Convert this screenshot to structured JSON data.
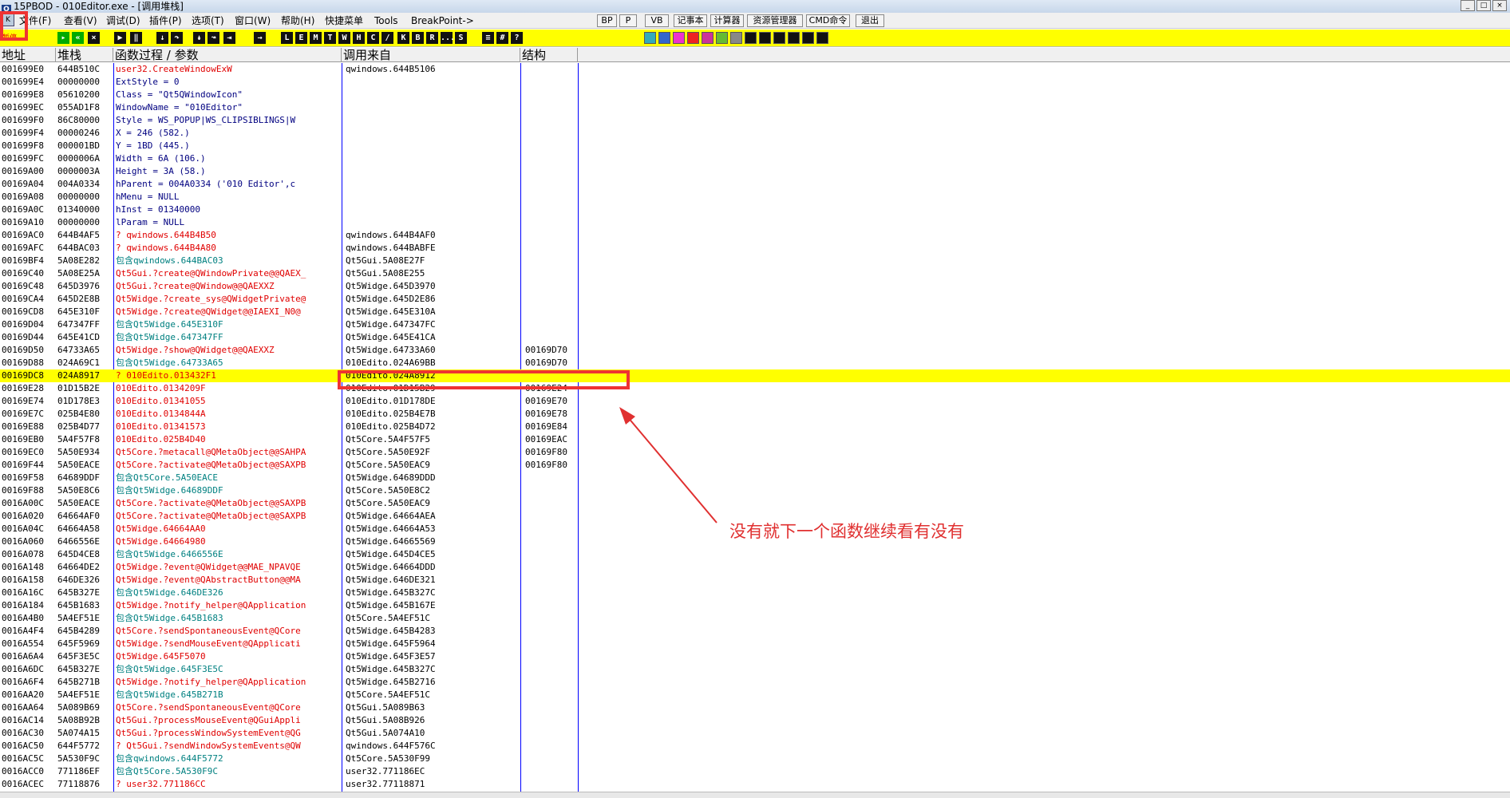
{
  "window": {
    "title": "15PBOD - 010Editor.exe - [调用堆栈]",
    "app_icon": "app-icon"
  },
  "menu": [
    "文件(F)",
    "查看(V)",
    "调试(D)",
    "插件(P)",
    "选项(T)",
    "窗口(W)",
    "帮助(H)",
    "快捷菜单",
    "Tools",
    "BreakPoint->"
  ],
  "plugin_buttons": [
    "BP",
    "P",
    "VB",
    "记事本",
    "计算器",
    "资源管理器",
    "CMD命令",
    "退出"
  ],
  "toolbar": {
    "status_text": "暂停",
    "left_icons": [
      "open",
      "restart",
      "close",
      "run",
      "pause",
      "step-into",
      "step-over",
      "trace-into",
      "trace-over",
      "execute-till-return",
      "goto"
    ],
    "letter_buttons": [
      "L",
      "E",
      "M",
      "T",
      "W",
      "H",
      "C",
      "/",
      "K",
      "B",
      "R",
      "...",
      "S"
    ],
    "right_icons": [
      "list",
      "grid",
      "help"
    ]
  },
  "columns": {
    "addr": "地址",
    "stack": "堆栈",
    "proc": "函数过程 / 参数",
    "called_from": "调用来自",
    "frame": "结构"
  },
  "rows": [
    {
      "addr": "001699E0",
      "stack": "644B510C",
      "proc": "user32.CreateWindowExW",
      "called_from": "qwindows.644B5106",
      "frame": "",
      "color": "red"
    },
    {
      "addr": "001699E4",
      "stack": "00000000",
      "proc": "  ExtStyle = 0",
      "called_from": "",
      "frame": "",
      "color": "navy"
    },
    {
      "addr": "001699E8",
      "stack": "05610200",
      "proc": "  Class = \"Qt5QWindowIcon\"",
      "called_from": "",
      "frame": "",
      "color": "navy"
    },
    {
      "addr": "001699EC",
      "stack": "055AD1F8",
      "proc": "  WindowName = \"010Editor\"",
      "called_from": "",
      "frame": "",
      "color": "navy"
    },
    {
      "addr": "001699F0",
      "stack": "86C80000",
      "proc": "  Style = WS_POPUP|WS_CLIPSIBLINGS|W",
      "called_from": "",
      "frame": "",
      "color": "navy"
    },
    {
      "addr": "001699F4",
      "stack": "00000246",
      "proc": "  X = 246 (582.)",
      "called_from": "",
      "frame": "",
      "color": "navy"
    },
    {
      "addr": "001699F8",
      "stack": "000001BD",
      "proc": "  Y = 1BD (445.)",
      "called_from": "",
      "frame": "",
      "color": "navy"
    },
    {
      "addr": "001699FC",
      "stack": "0000006A",
      "proc": "  Width = 6A (106.)",
      "called_from": "",
      "frame": "",
      "color": "navy"
    },
    {
      "addr": "00169A00",
      "stack": "0000003A",
      "proc": "  Height = 3A (58.)",
      "called_from": "",
      "frame": "",
      "color": "navy"
    },
    {
      "addr": "00169A04",
      "stack": "004A0334",
      "proc": "  hParent = 004A0334 ('010 Editor',c",
      "called_from": "",
      "frame": "",
      "color": "navy"
    },
    {
      "addr": "00169A08",
      "stack": "00000000",
      "proc": "  hMenu = NULL",
      "called_from": "",
      "frame": "",
      "color": "navy"
    },
    {
      "addr": "00169A0C",
      "stack": "01340000",
      "proc": "  hInst = 01340000",
      "called_from": "",
      "frame": "",
      "color": "navy"
    },
    {
      "addr": "00169A10",
      "stack": "00000000",
      "proc": "  lParam = NULL",
      "called_from": "",
      "frame": "",
      "color": "navy"
    },
    {
      "addr": "00169AC0",
      "stack": "644B4AF5",
      "proc": "? qwindows.644B4B50",
      "called_from": "qwindows.644B4AF0",
      "frame": "",
      "color": "red"
    },
    {
      "addr": "00169AFC",
      "stack": "644BAC03",
      "proc": "? qwindows.644B4A80",
      "called_from": "qwindows.644BABFE",
      "frame": "",
      "color": "red"
    },
    {
      "addr": "00169BF4",
      "stack": "5A08E282",
      "proc": "包含qwindows.644BAC03",
      "called_from": "Qt5Gui.5A08E27F",
      "frame": "",
      "color": "teal"
    },
    {
      "addr": "00169C40",
      "stack": "5A08E25A",
      "proc": "Qt5Gui.?create@QWindowPrivate@@QAEX_",
      "called_from": "Qt5Gui.5A08E255",
      "frame": "",
      "color": "red"
    },
    {
      "addr": "00169C48",
      "stack": "645D3976",
      "proc": "Qt5Gui.?create@QWindow@@QAEXXZ",
      "called_from": "Qt5Widge.645D3970",
      "frame": "",
      "color": "red"
    },
    {
      "addr": "00169CA4",
      "stack": "645D2E8B",
      "proc": "Qt5Widge.?create_sys@QWidgetPrivate@",
      "called_from": "Qt5Widge.645D2E86",
      "frame": "",
      "color": "red"
    },
    {
      "addr": "00169CD8",
      "stack": "645E310F",
      "proc": "Qt5Widge.?create@QWidget@@IAEXI_N0@",
      "called_from": "Qt5Widge.645E310A",
      "frame": "",
      "color": "red"
    },
    {
      "addr": "00169D04",
      "stack": "647347FF",
      "proc": "包含Qt5Widge.645E310F",
      "called_from": "Qt5Widge.647347FC",
      "frame": "",
      "color": "teal"
    },
    {
      "addr": "00169D44",
      "stack": "645E41CD",
      "proc": "包含Qt5Widge.647347FF",
      "called_from": "Qt5Widge.645E41CA",
      "frame": "",
      "color": "teal"
    },
    {
      "addr": "00169D50",
      "stack": "64733A65",
      "proc": "Qt5Widge.?show@QWidget@@QAEXXZ",
      "called_from": "Qt5Widge.64733A60",
      "frame": "00169D70",
      "color": "red"
    },
    {
      "addr": "00169D88",
      "stack": "024A69C1",
      "proc": "包含Qt5Widge.64733A65",
      "called_from": "010Edito.024A69BB",
      "frame": "00169D70",
      "color": "teal"
    },
    {
      "addr": "00169DC8",
      "stack": "024A8917",
      "proc": "? 010Edito.013432F1",
      "called_from": "010Edito.024A8912",
      "frame": "",
      "color": "red",
      "highlight": true
    },
    {
      "addr": "00169E28",
      "stack": "01D15B2E",
      "proc": " 010Edito.0134209F",
      "called_from": "010Edito.01D15B29",
      "frame": "00169E24",
      "color": "red"
    },
    {
      "addr": "00169E74",
      "stack": "01D178E3",
      "proc": " 010Edito.01341055",
      "called_from": "010Edito.01D178DE",
      "frame": "00169E70",
      "color": "red"
    },
    {
      "addr": "00169E7C",
      "stack": "025B4E80",
      "proc": " 010Edito.0134844A",
      "called_from": "010Edito.025B4E7B",
      "frame": "00169E78",
      "color": "red"
    },
    {
      "addr": "00169E88",
      "stack": "025B4D77",
      "proc": " 010Edito.01341573",
      "called_from": "010Edito.025B4D72",
      "frame": "00169E84",
      "color": "red"
    },
    {
      "addr": "00169EB0",
      "stack": "5A4F57F8",
      "proc": " 010Edito.025B4D40",
      "called_from": "Qt5Core.5A4F57F5",
      "frame": "00169EAC",
      "color": "red"
    },
    {
      "addr": "00169EC0",
      "stack": "5A50E934",
      "proc": "Qt5Core.?metacall@QMetaObject@@SAHPA",
      "called_from": "Qt5Core.5A50E92F",
      "frame": "00169F80",
      "color": "red"
    },
    {
      "addr": "00169F44",
      "stack": "5A50EACE",
      "proc": "Qt5Core.?activate@QMetaObject@@SAXPB",
      "called_from": "Qt5Core.5A50EAC9",
      "frame": "00169F80",
      "color": "red"
    },
    {
      "addr": "00169F58",
      "stack": "64689DDF",
      "proc": "包含Qt5Core.5A50EACE",
      "called_from": "Qt5Widge.64689DDD",
      "frame": "",
      "color": "teal"
    },
    {
      "addr": "00169F88",
      "stack": "5A50E8C6",
      "proc": "包含Qt5Widge.64689DDF",
      "called_from": "Qt5Core.5A50E8C2",
      "frame": "",
      "color": "teal"
    },
    {
      "addr": "0016A00C",
      "stack": "5A50EACE",
      "proc": "Qt5Core.?activate@QMetaObject@@SAXPB",
      "called_from": "Qt5Core.5A50EAC9",
      "frame": "",
      "color": "red"
    },
    {
      "addr": "0016A020",
      "stack": "64664AF0",
      "proc": "Qt5Core.?activate@QMetaObject@@SAXPB",
      "called_from": "Qt5Widge.64664AEA",
      "frame": "",
      "color": "red"
    },
    {
      "addr": "0016A04C",
      "stack": "64664A58",
      "proc": "Qt5Widge.64664AA0",
      "called_from": "Qt5Widge.64664A53",
      "frame": "",
      "color": "red"
    },
    {
      "addr": "0016A060",
      "stack": "6466556E",
      "proc": "Qt5Widge.64664980",
      "called_from": "Qt5Widge.64665569",
      "frame": "",
      "color": "red"
    },
    {
      "addr": "0016A078",
      "stack": "645D4CE8",
      "proc": "包含Qt5Widge.6466556E",
      "called_from": "Qt5Widge.645D4CE5",
      "frame": "",
      "color": "teal"
    },
    {
      "addr": "0016A148",
      "stack": "64664DE2",
      "proc": "Qt5Widge.?event@QWidget@@MAE_NPAVQE",
      "called_from": "Qt5Widge.64664DDD",
      "frame": "",
      "color": "red"
    },
    {
      "addr": "0016A158",
      "stack": "646DE326",
      "proc": "Qt5Widge.?event@QAbstractButton@@MA",
      "called_from": "Qt5Widge.646DE321",
      "frame": "",
      "color": "red"
    },
    {
      "addr": "0016A16C",
      "stack": "645B327E",
      "proc": "包含Qt5Widge.646DE326",
      "called_from": "Qt5Widge.645B327C",
      "frame": "",
      "color": "teal"
    },
    {
      "addr": "0016A184",
      "stack": "645B1683",
      "proc": "Qt5Widge.?notify_helper@QApplication",
      "called_from": "Qt5Widge.645B167E",
      "frame": "",
      "color": "red"
    },
    {
      "addr": "0016A4B0",
      "stack": "5A4EF51E",
      "proc": "包含Qt5Widge.645B1683",
      "called_from": "Qt5Core.5A4EF51C",
      "frame": "",
      "color": "teal"
    },
    {
      "addr": "0016A4F4",
      "stack": "645B4289",
      "proc": "Qt5Core.?sendSpontaneousEvent@QCore",
      "called_from": "Qt5Widge.645B4283",
      "frame": "",
      "color": "red"
    },
    {
      "addr": "0016A554",
      "stack": "645F5969",
      "proc": "Qt5Widge.?sendMouseEvent@QApplicati",
      "called_from": "Qt5Widge.645F5964",
      "frame": "",
      "color": "red"
    },
    {
      "addr": "0016A6A4",
      "stack": "645F3E5C",
      "proc": "Qt5Widge.645F5070",
      "called_from": "Qt5Widge.645F3E57",
      "frame": "",
      "color": "red"
    },
    {
      "addr": "0016A6DC",
      "stack": "645B327E",
      "proc": "包含Qt5Widge.645F3E5C",
      "called_from": "Qt5Widge.645B327C",
      "frame": "",
      "color": "teal"
    },
    {
      "addr": "0016A6F4",
      "stack": "645B271B",
      "proc": "Qt5Widge.?notify_helper@QApplication",
      "called_from": "Qt5Widge.645B2716",
      "frame": "",
      "color": "red"
    },
    {
      "addr": "0016AA20",
      "stack": "5A4EF51E",
      "proc": "包含Qt5Widge.645B271B",
      "called_from": "Qt5Core.5A4EF51C",
      "frame": "",
      "color": "teal"
    },
    {
      "addr": "0016AA64",
      "stack": "5A089B69",
      "proc": "Qt5Core.?sendSpontaneousEvent@QCore",
      "called_from": "Qt5Gui.5A089B63",
      "frame": "",
      "color": "red"
    },
    {
      "addr": "0016AC14",
      "stack": "5A08B92B",
      "proc": "Qt5Gui.?processMouseEvent@QGuiAppli",
      "called_from": "Qt5Gui.5A08B926",
      "frame": "",
      "color": "red"
    },
    {
      "addr": "0016AC30",
      "stack": "5A074A15",
      "proc": "Qt5Gui.?processWindowSystemEvent@QG",
      "called_from": "Qt5Gui.5A074A10",
      "frame": "",
      "color": "red"
    },
    {
      "addr": "0016AC50",
      "stack": "644F5772",
      "proc": "? Qt5Gui.?sendWindowSystemEvents@QW",
      "called_from": "qwindows.644F576C",
      "frame": "",
      "color": "red"
    },
    {
      "addr": "0016AC5C",
      "stack": "5A530F9C",
      "proc": "包含qwindows.644F5772",
      "called_from": "Qt5Core.5A530F99",
      "frame": "",
      "color": "teal"
    },
    {
      "addr": "0016ACC0",
      "stack": "771186EF",
      "proc": "包含Qt5Core.5A530F9C",
      "called_from": "user32.771186EC",
      "frame": "",
      "color": "teal"
    },
    {
      "addr": "0016ACEC",
      "stack": "77118876",
      "proc": "? user32.771186CC",
      "called_from": "user32.77118871",
      "frame": "",
      "color": "red"
    }
  ],
  "annotation": {
    "text": "没有就下一个函数继续看有没有",
    "color": "#e03030"
  },
  "colors": {
    "highlight": "#ffff00",
    "call_red": "#e00000",
    "contains_teal": "#008080",
    "param_navy": "#000080",
    "column_divider": "#0000ff",
    "toolbar_bg": "#ffff00"
  }
}
